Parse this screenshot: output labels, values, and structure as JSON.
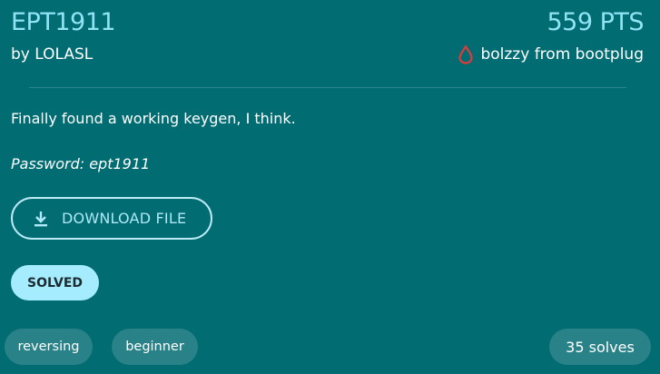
{
  "challenge": {
    "title": "EPT1911",
    "points": "559 PTS",
    "author": "by LOLASL",
    "first_blood": "bolzzy from bootplug",
    "description": "Finally found a working keygen, I think.",
    "password": "Password: ept1911",
    "download_label": "DOWNLOAD FILE",
    "status": "SOLVED",
    "tags": [
      "reversing",
      "beginner"
    ],
    "solves": "35 solves"
  },
  "icons": {
    "first_blood": "blood-drop-icon",
    "download": "download-icon"
  },
  "colors": {
    "background": "#026c73",
    "accent": "#8fe3f4",
    "blood": "#e03a3a",
    "solved_badge": "#a6ecff",
    "pill": "#2a8289"
  }
}
